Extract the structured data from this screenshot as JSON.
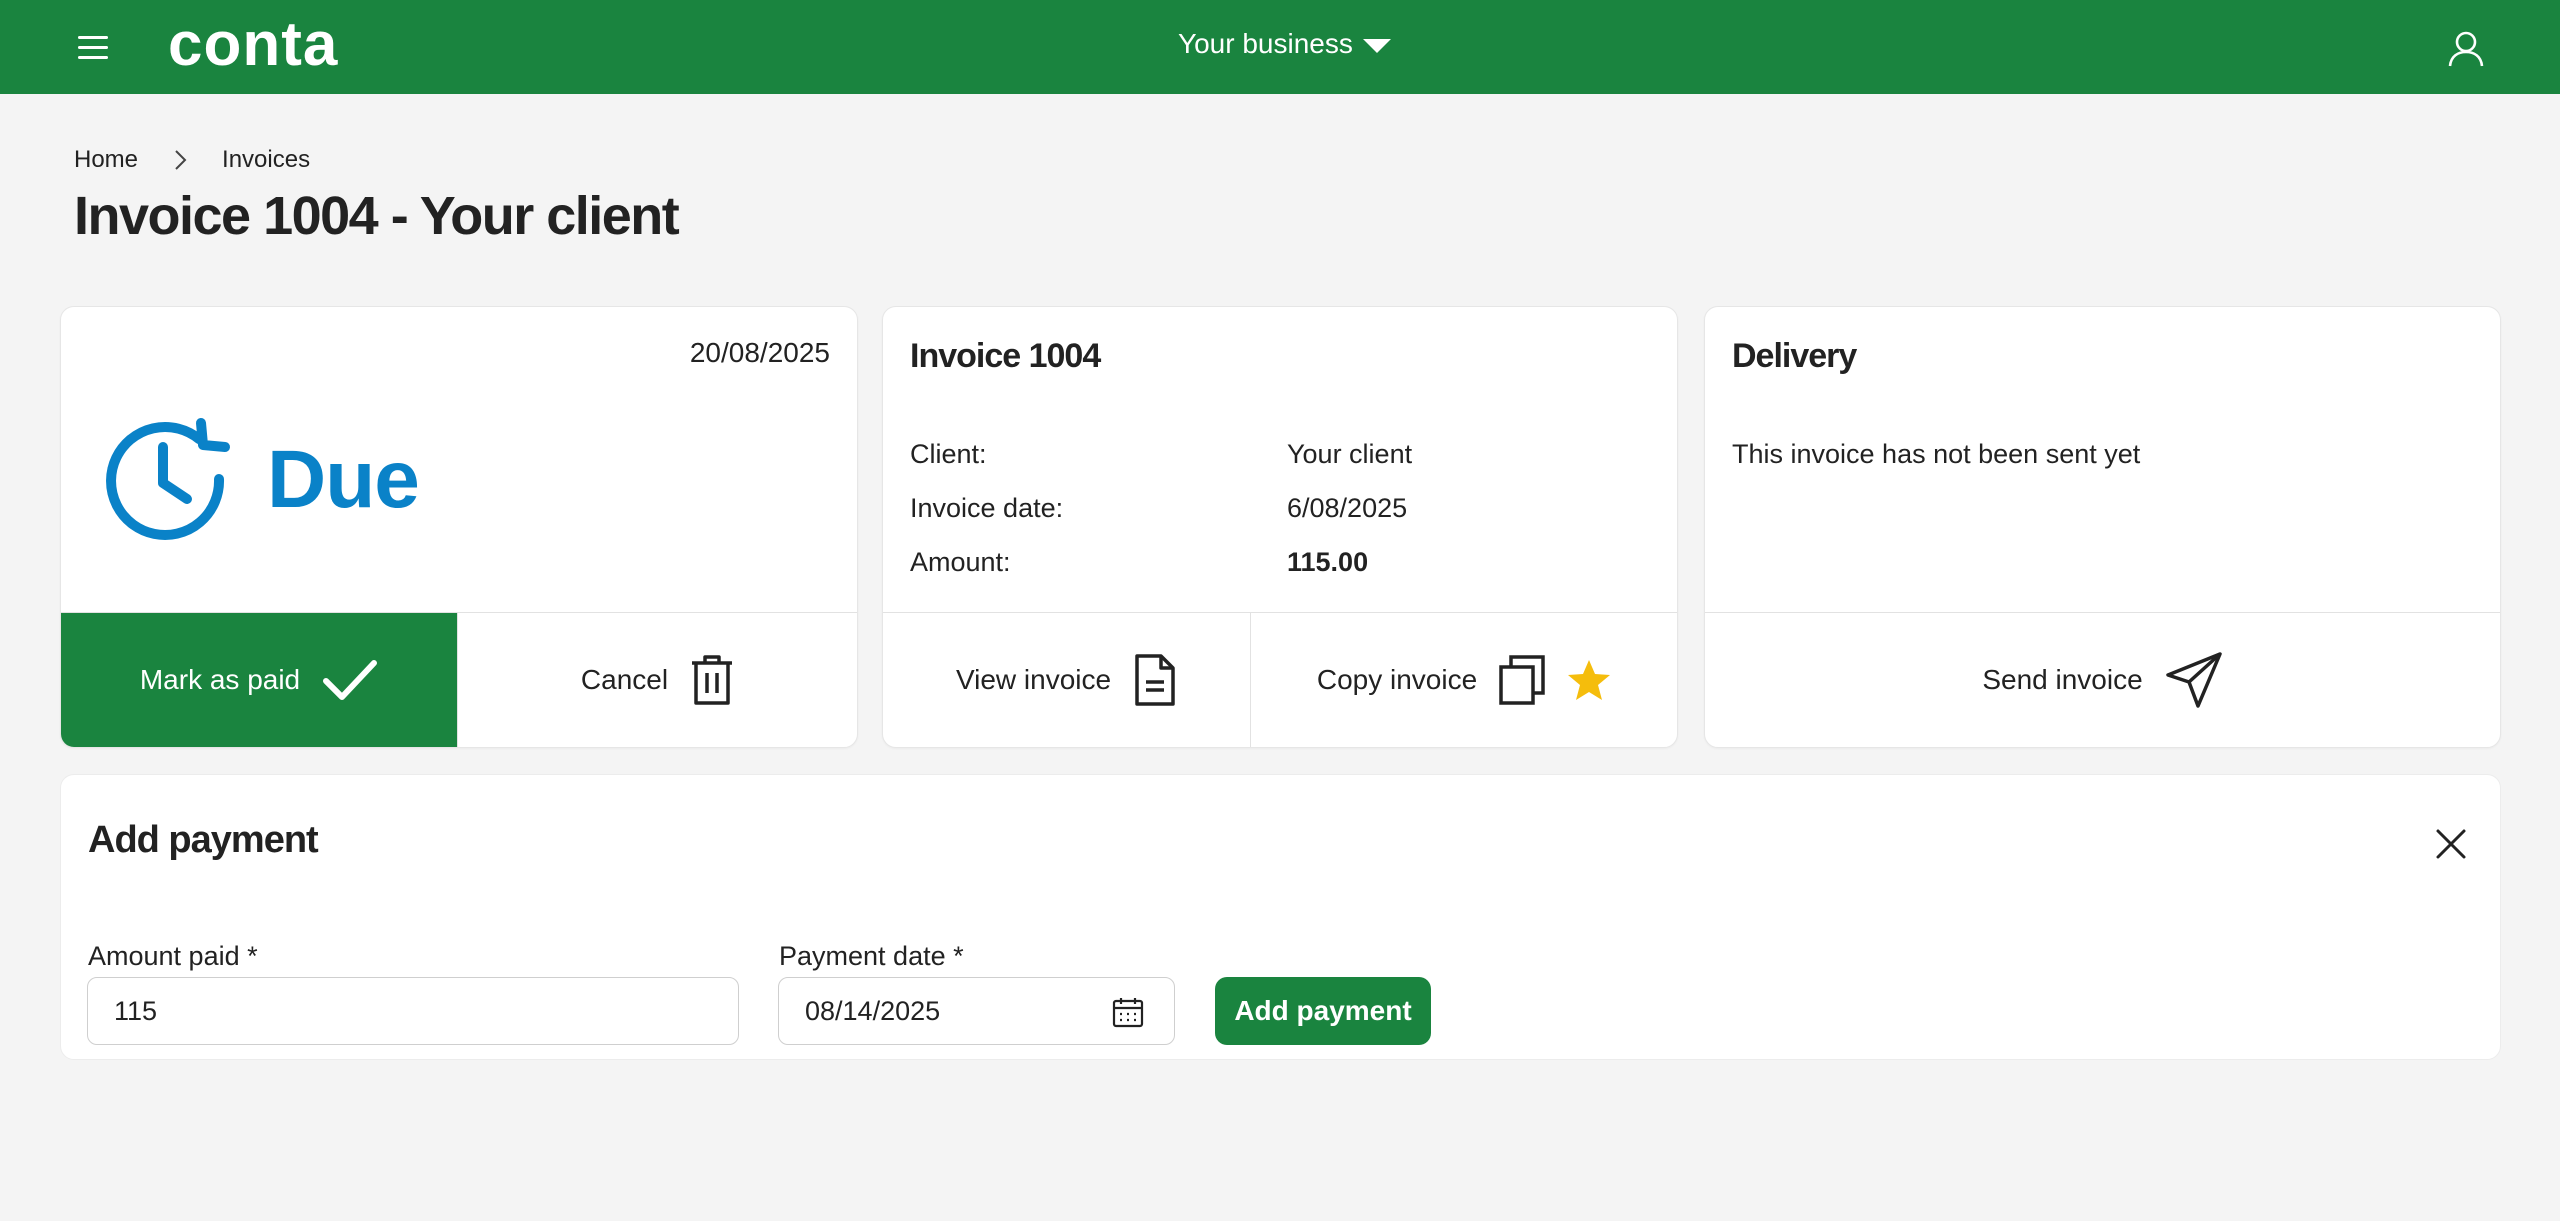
{
  "header": {
    "logo": "conta",
    "business_selector": "Your business",
    "brand_color": "#1a843f"
  },
  "breadcrumb": {
    "items": [
      "Home",
      "Invoices"
    ]
  },
  "page": {
    "title": "Invoice 1004 - Your client"
  },
  "status_card": {
    "date": "20/08/2025",
    "status": "Due",
    "status_color": "#0a82c8",
    "actions": {
      "mark_paid": "Mark as paid",
      "cancel": "Cancel"
    }
  },
  "invoice_card": {
    "title": "Invoice 1004",
    "rows": [
      {
        "label": "Client:",
        "value": "Your client"
      },
      {
        "label": "Invoice date:",
        "value": "6/08/2025"
      },
      {
        "label": "Amount:",
        "value": "115.00"
      }
    ],
    "actions": {
      "view": "View invoice",
      "copy": "Copy invoice"
    }
  },
  "delivery_card": {
    "title": "Delivery",
    "message": "This invoice has not been sent yet",
    "actions": {
      "send": "Send invoice"
    }
  },
  "add_payment": {
    "title": "Add payment",
    "amount_label": "Amount paid *",
    "amount_value": "115",
    "date_label": "Payment date *",
    "date_value": "08/14/2025",
    "submit_label": "Add payment"
  }
}
